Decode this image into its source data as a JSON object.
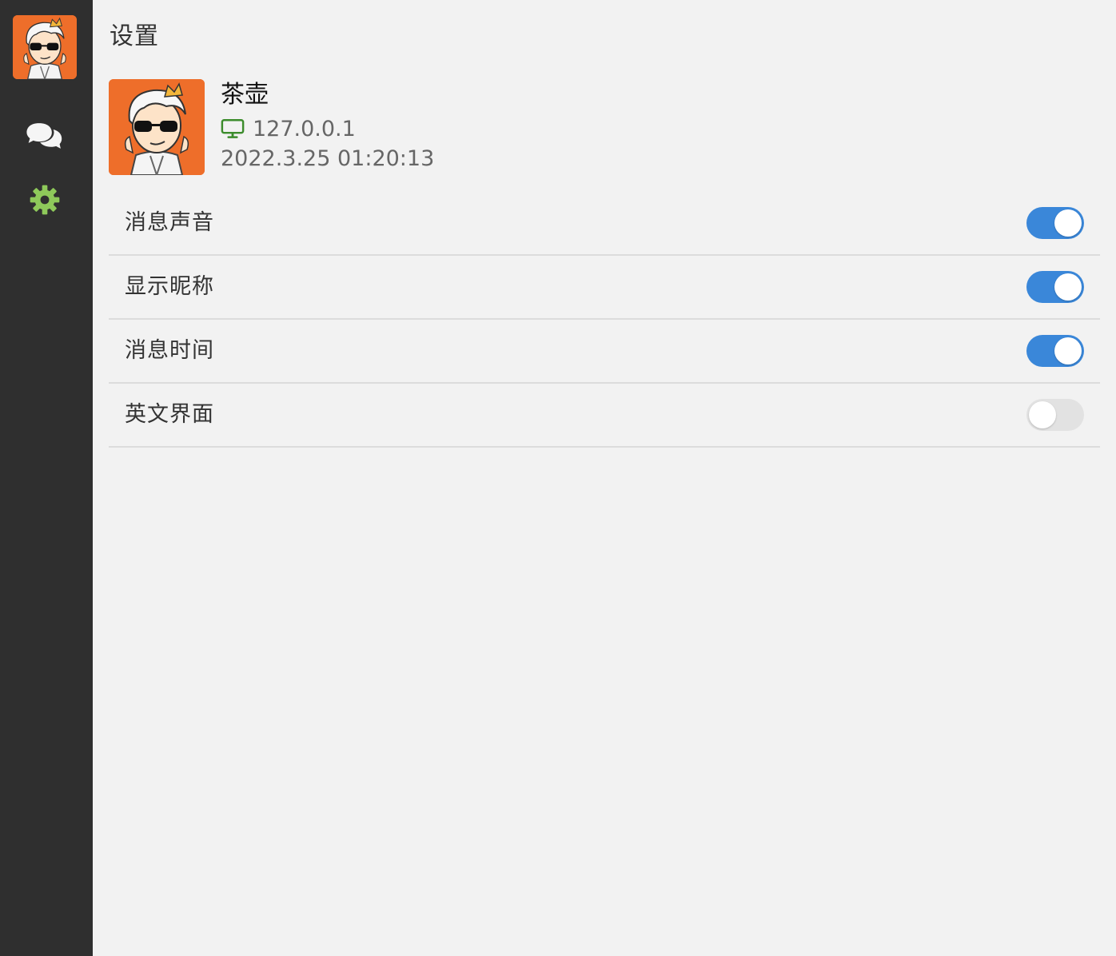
{
  "sidebar": {
    "avatar_icon": "avatar-sunglasses-icon",
    "nav": [
      {
        "id": "chat",
        "icon": "chat-bubbles-icon",
        "active": false
      },
      {
        "id": "settings",
        "icon": "gear-icon",
        "active": true
      }
    ]
  },
  "page": {
    "title": "设置"
  },
  "profile": {
    "name": "茶壶",
    "ip_icon": "monitor-icon",
    "ip": "127.0.0.1",
    "time": "2022.3.25 01:20:13"
  },
  "settings": [
    {
      "label": "消息声音",
      "enabled": true
    },
    {
      "label": "显示昵称",
      "enabled": true
    },
    {
      "label": "消息时间",
      "enabled": true
    },
    {
      "label": "英文界面",
      "enabled": false
    }
  ],
  "colors": {
    "sidebar_bg": "#2f2f2f",
    "main_bg": "#f2f2f2",
    "toggle_on": "#3a87d9",
    "toggle_off": "#e2e2e2",
    "gear_active": "#8ec95a",
    "monitor_icon": "#3c8c2c",
    "avatar_bg": "#ee6e2a"
  }
}
